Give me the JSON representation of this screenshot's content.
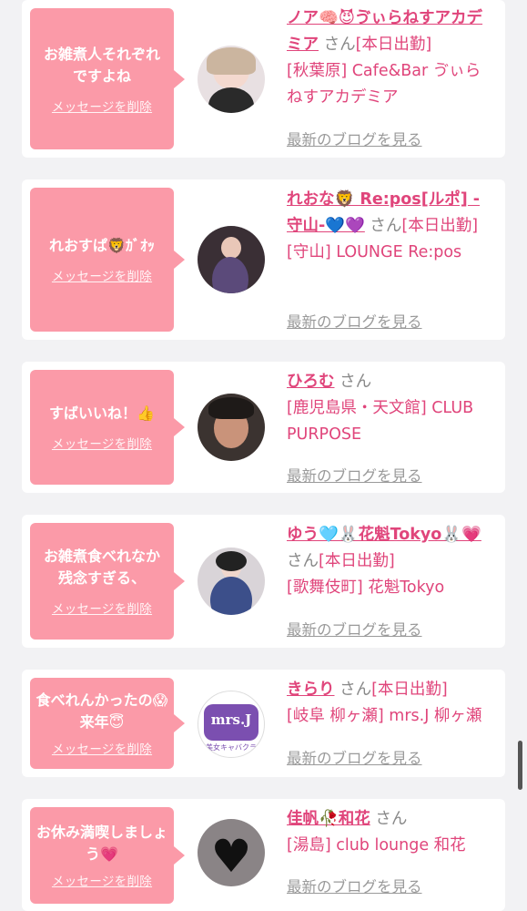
{
  "cards": [
    {
      "message": "お雑煮人それぞれですよね",
      "delete_label": "メッセージを削除",
      "name": "ノア🧠😈ゔぃらねすアカデミア",
      "san": "さん",
      "status": "[本日出勤]",
      "shop": "[秋葉原] Cafe&Bar ゔぃらねすアカデミア",
      "blog_label": "最新のブログを見る",
      "avatar_icon": "avatar-photo"
    },
    {
      "message": "れおすぱ🦁ｶﾞｵｯ",
      "delete_label": "メッセージを削除",
      "name": "れおな🦁 Re:pos[ルポ] - 守山-💙💜",
      "san": "さん",
      "status": "[本日出勤]",
      "shop": "[守山] LOUNGE Re:pos",
      "blog_label": "最新のブログを見る",
      "avatar_icon": "avatar-photo"
    },
    {
      "message": "すばいいね！👍",
      "delete_label": "メッセージを削除",
      "name": "ひろむ",
      "san": "さん",
      "status": "",
      "shop": "[鹿児島県・天文館] CLUB PURPOSE",
      "blog_label": "最新のブログを見る",
      "avatar_icon": "avatar-photo"
    },
    {
      "message": "お雑煮食べれなか残念すぎる、",
      "delete_label": "メッセージを削除",
      "name": "ゆう🩵🐰花魁Tokyo🐰💗",
      "san": "さん",
      "status": "[本日出勤]",
      "shop": "[歌舞伎町] 花魁Tokyo",
      "blog_label": "最新のブログを見る",
      "avatar_icon": "avatar-photo"
    },
    {
      "message": "食べれんかったの😱来年😇",
      "delete_label": "メッセージを削除",
      "name": "きらり",
      "san": "さん",
      "status": "[本日出勤]",
      "shop": "[岐阜 柳ヶ瀬] mrs.J 柳ヶ瀬",
      "blog_label": "最新のブログを見る",
      "avatar_icon": "avatar-logo",
      "avatar_logo_text": "mrs.J",
      "avatar_logo_sub": "美女キャバクラ"
    },
    {
      "message": "お休み満喫しましょう💗",
      "delete_label": "メッセージを削除",
      "name": "佳帆🥀和花",
      "san": "さん",
      "status": "",
      "shop": "[湯島] club lounge 和花",
      "blog_label": "最新のブログを見る",
      "avatar_icon": "avatar-heart"
    }
  ]
}
